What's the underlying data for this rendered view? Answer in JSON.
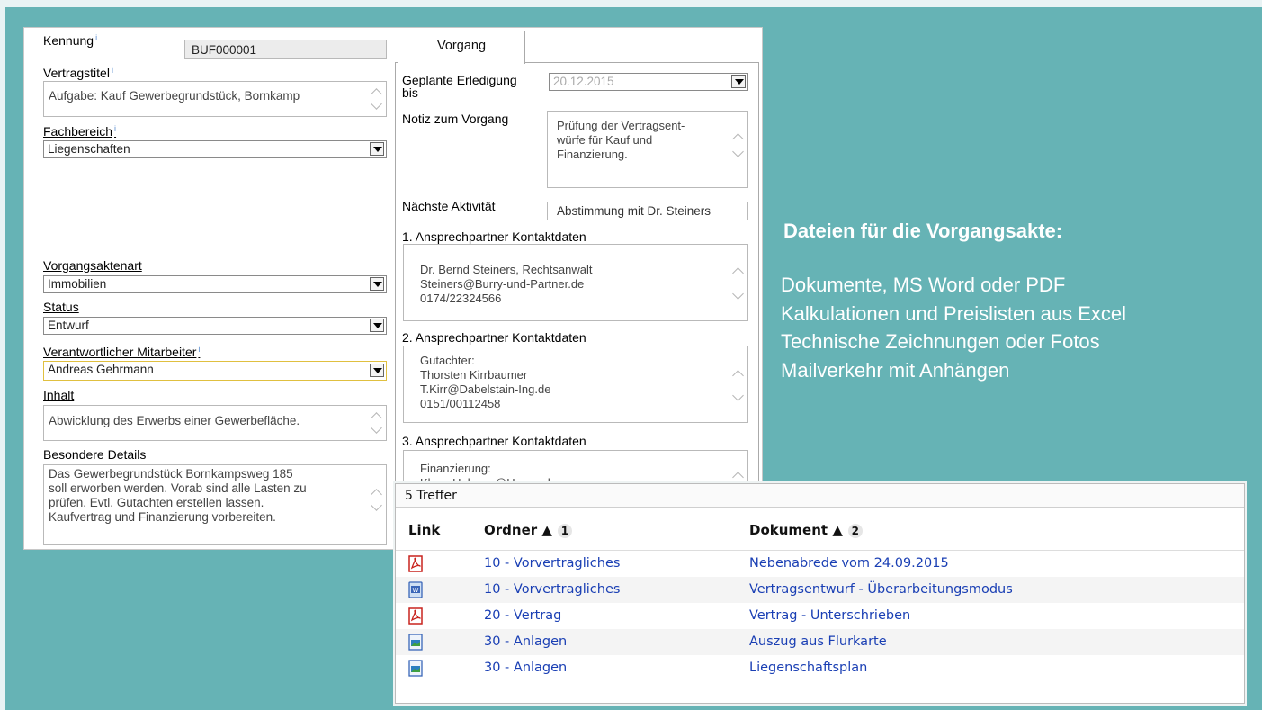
{
  "form": {
    "kennung": {
      "label": "Kennung",
      "value": "BUF000001"
    },
    "vertragstitel": {
      "label": "Vertragstitel",
      "value": "Aufgabe: Kauf Gewerbegrundstück, Bornkamp"
    },
    "fachbereich": {
      "label": "Fachbereich",
      "value": "Liegenschaften"
    },
    "vorgangsaktenart": {
      "label": "Vorgangsaktenart",
      "value": "Immobilien"
    },
    "status": {
      "label": "Status",
      "value": "Entwurf"
    },
    "mitarbeiter": {
      "label": "Verantwortlicher Mitarbeiter",
      "value": "Andreas Gehrmann"
    },
    "inhalt": {
      "label": "Inhalt",
      "value": "Abwicklung des Erwerbs einer Gewerbefläche."
    },
    "details": {
      "label": "Besondere Details",
      "lines": [
        "Das Gewerbegrundstück Bornkampsweg 185",
        "soll erworben werden. Vorab sind alle Lasten zu",
        "prüfen. Evtl. Gutachten erstellen lassen.",
        "Kaufvertrag und Finanzierung vorbereiten."
      ]
    }
  },
  "vorgang": {
    "tab_label": "Vorgang",
    "erledigung": {
      "label_line1": "Geplante Erledigung",
      "label_line2": "bis",
      "value": "20.12.2015"
    },
    "notiz": {
      "label": "Notiz zum Vorgang",
      "lines": [
        "Prüfung der Vertragsent-",
        "würfe für Kauf und",
        "Finanzierung."
      ]
    },
    "aktivitaet": {
      "label": "Nächste Aktivität",
      "value": "Abstimmung mit Dr. Steiners"
    },
    "contact1": {
      "label": "1. Ansprechpartner Kontaktdaten",
      "lines": [
        "Dr. Bernd Steiners, Rechtsanwalt",
        "Steiners@Burry-und-Partner.de",
        "0174/22324566"
      ]
    },
    "contact2": {
      "label": "2. Ansprechpartner Kontaktdaten",
      "lines": [
        "Gutachter:",
        "Thorsten Kirrbaumer",
        "T.Kirr@Dabelstain-Ing.de",
        "0151/00112458"
      ]
    },
    "contact3": {
      "label": "3. Ansprechpartner Kontaktdaten",
      "lines": [
        "Finanzierung:",
        "Klaus Heberer@Haspa.de"
      ]
    }
  },
  "info": {
    "title": "Dateien für die Vorgangsakte:",
    "lines": [
      "Dokumente, MS Word oder PDF",
      "Kalkulationen und Preislisten aus Excel",
      "Technische Zeichnungen oder Fotos",
      "Mailverkehr mit Anhängen"
    ]
  },
  "results": {
    "count_label": "5 Treffer",
    "columns": {
      "link": "Link",
      "ordner": "Ordner",
      "ordner_sort": "1",
      "dokument": "Dokument",
      "dokument_sort": "2"
    },
    "rows": [
      {
        "icon": "pdf-icon",
        "ordner": "10 - Vorvertragliches",
        "dokument": "Nebenabrede vom 24.09.2015"
      },
      {
        "icon": "word-icon",
        "ordner": "10 - Vorvertragliches",
        "dokument": "Vertragsentwurf - Überarbeitungsmodus"
      },
      {
        "icon": "pdf-icon",
        "ordner": "20 - Vertrag",
        "dokument": "Vertrag - Unterschrieben"
      },
      {
        "icon": "image-icon",
        "ordner": "30 - Anlagen",
        "dokument": "Auszug aus Flurkarte"
      },
      {
        "icon": "image-icon",
        "ordner": "30 - Anlagen",
        "dokument": "Liegenschaftsplan"
      }
    ]
  },
  "colors": {
    "background": "#66b3b5",
    "link": "#1a3fb4",
    "pdf": "#c8231e",
    "word": "#3a66b8"
  }
}
